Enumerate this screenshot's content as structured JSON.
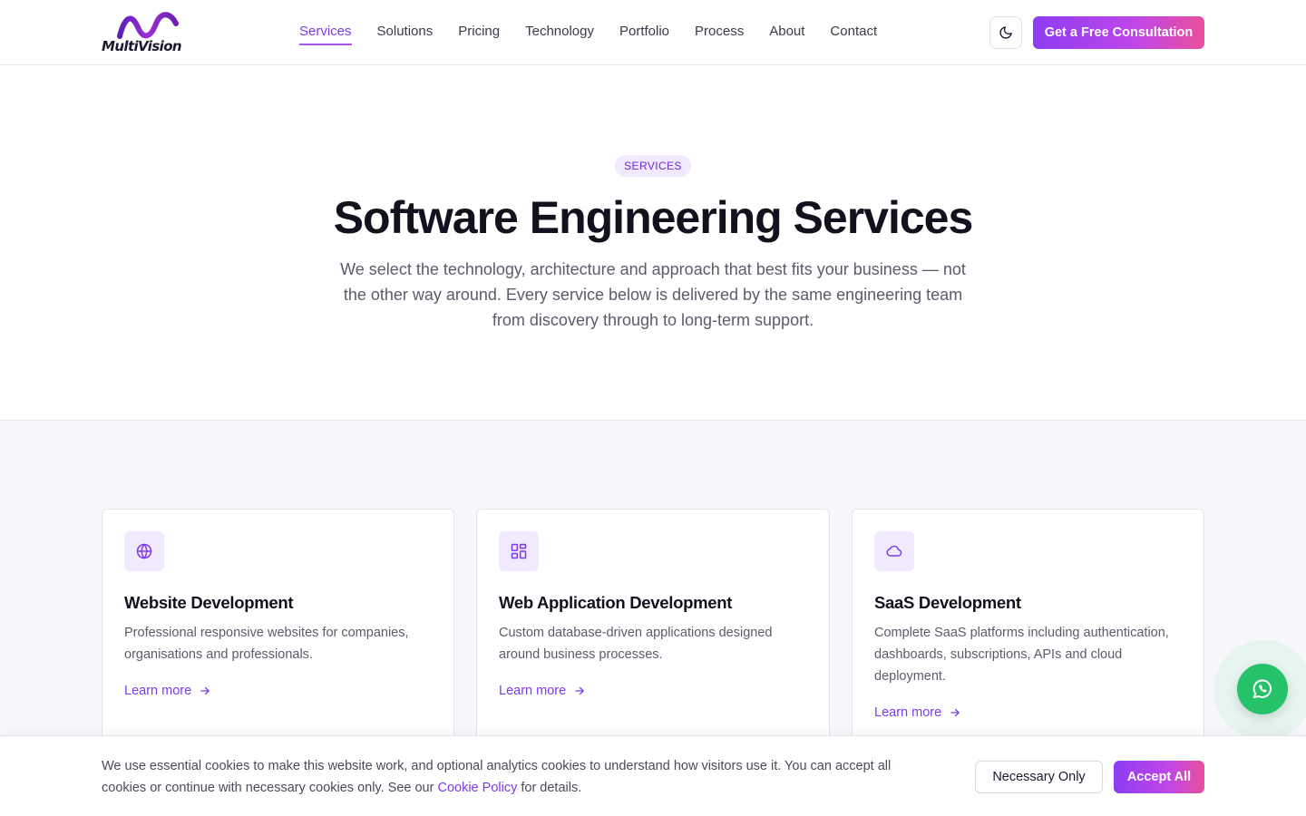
{
  "brand": {
    "logo_text": "MultiVision",
    "logo_icon": "wave-logo-icon",
    "accent": "#7c3aed",
    "gradient_end": "#e94f9b"
  },
  "nav": {
    "items": [
      {
        "label": "Services",
        "active": true
      },
      {
        "label": "Solutions"
      },
      {
        "label": "Pricing"
      },
      {
        "label": "Technology"
      },
      {
        "label": "Portfolio"
      },
      {
        "label": "Process"
      },
      {
        "label": "About"
      },
      {
        "label": "Contact"
      }
    ],
    "theme_toggle_icon": "moon-icon",
    "cta_label": "Get a Free Consultation"
  },
  "hero": {
    "badge": "SERVICES",
    "title": "Software Engineering Services",
    "subtitle": "We select the technology, architecture and approach that best fits your business — not the other way around. Every service below is delivered by the same engineering team from discovery through to long-term support."
  },
  "services": {
    "cards": [
      {
        "icon": "globe-icon",
        "title": "Website Development",
        "description": "Professional responsive websites for companies, organisations and professionals.",
        "link": "Learn more"
      },
      {
        "icon": "grid-icon",
        "title": "Web Application Development",
        "description": "Custom database-driven applications designed around business processes.",
        "link": "Learn more"
      },
      {
        "icon": "cloud-icon",
        "title": "SaaS Development",
        "description": "Complete SaaS platforms including authentication, dashboards, subscriptions, APIs and cloud deployment.",
        "link": "Learn more"
      }
    ]
  },
  "whatsapp": {
    "icon": "whatsapp-icon",
    "color": "#25c26a"
  },
  "cookie": {
    "text_before": "We use essential cookies to make this website work, and optional analytics cookies to understand how visitors use it. You can accept all cookies or continue with necessary cookies only. See our ",
    "policy_link": "Cookie Policy",
    "text_after": " for details.",
    "necessary_label": "Necessary Only",
    "accept_label": "Accept All"
  }
}
